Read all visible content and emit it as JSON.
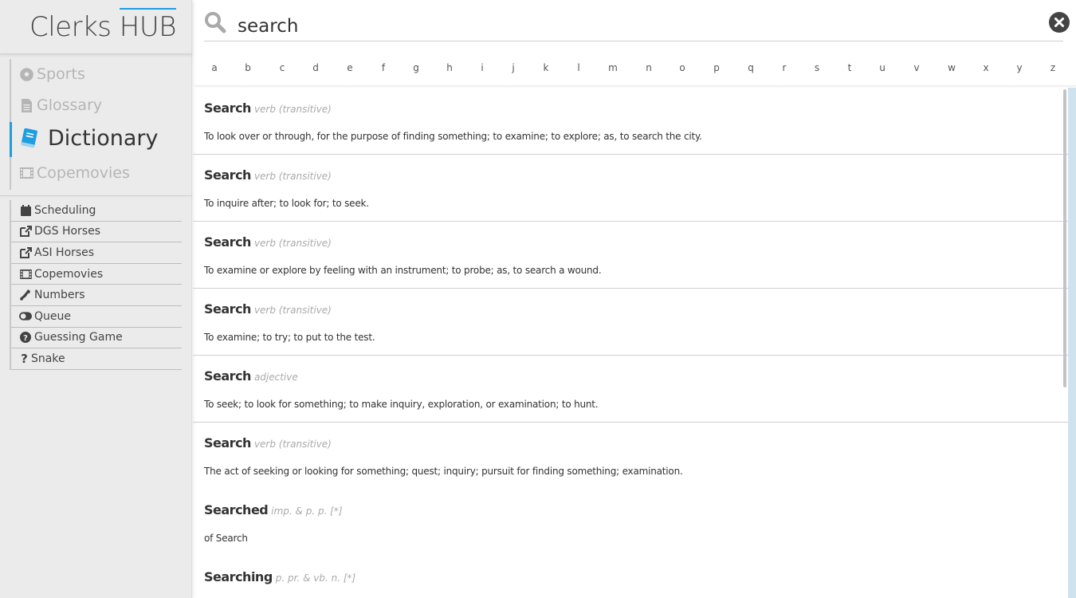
{
  "app": {
    "logo_part1": "Clerks ",
    "logo_part2": "HUB"
  },
  "colors": {
    "accent": "#1e9de0",
    "sidebar_bg": "#ebebeb"
  },
  "main_nav": [
    {
      "label": "Sports",
      "icon": "soccer-ball-icon",
      "active": false
    },
    {
      "label": "Glossary",
      "icon": "file-icon",
      "active": false
    },
    {
      "label": "Dictionary",
      "icon": "book-icon",
      "active": true
    },
    {
      "label": "Copemovies",
      "icon": "film-icon",
      "active": false
    }
  ],
  "sub_nav": [
    {
      "label": "Scheduling",
      "icon": "calendar-icon"
    },
    {
      "label": "DGS Horses",
      "icon": "external-link-icon"
    },
    {
      "label": "ASI Horses",
      "icon": "external-link-icon"
    },
    {
      "label": "Copemovies",
      "icon": "film-icon"
    },
    {
      "label": "Numbers",
      "icon": "phone-icon"
    },
    {
      "label": "Queue",
      "icon": "toggle-icon"
    },
    {
      "label": "Guessing Game",
      "icon": "question-circle-icon"
    },
    {
      "label": "Snake",
      "icon": "question-icon"
    }
  ],
  "search": {
    "value": "search"
  },
  "alphabet": [
    "a",
    "b",
    "c",
    "d",
    "e",
    "f",
    "g",
    "h",
    "i",
    "j",
    "k",
    "l",
    "m",
    "n",
    "o",
    "p",
    "q",
    "r",
    "s",
    "t",
    "u",
    "v",
    "w",
    "x",
    "y",
    "z"
  ],
  "results": [
    {
      "word": "Search",
      "pos": "verb (transitive)",
      "definition": "To look over or through, for the purpose of finding something; to examine; to explore; as, to search the city."
    },
    {
      "word": "Search",
      "pos": "verb (transitive)",
      "definition": "To inquire after; to look for; to seek."
    },
    {
      "word": "Search",
      "pos": "verb (transitive)",
      "definition": "To examine or explore by feeling with an instrument; to probe; as, to search a wound."
    },
    {
      "word": "Search",
      "pos": "verb (transitive)",
      "definition": "To examine; to try; to put to the test."
    },
    {
      "word": "Search",
      "pos": "adjective",
      "definition": "To seek; to look for something; to make inquiry, exploration, or examination; to hunt."
    },
    {
      "word": "Search",
      "pos": "verb (transitive)",
      "definition": "The act of seeking or looking for something; quest; inquiry; pursuit for finding something; examination."
    },
    {
      "word": "Searched",
      "pos": "imp. & p. p. [*]",
      "definition": "of Search"
    },
    {
      "word": "Searching",
      "pos": "p. pr. & vb. n. [*]",
      "definition": ""
    }
  ]
}
